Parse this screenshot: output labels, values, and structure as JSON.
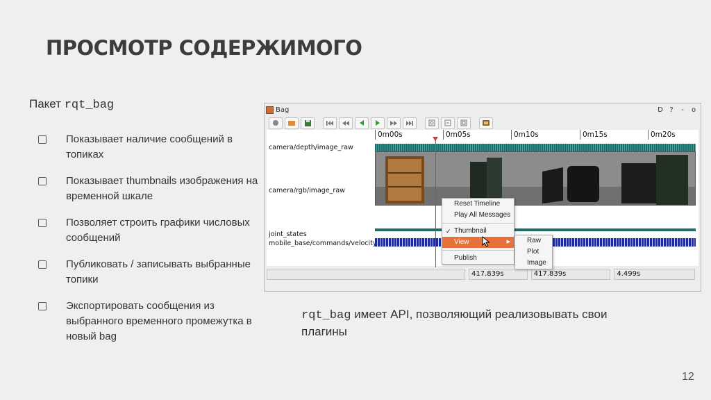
{
  "slide": {
    "title": "ПРОСМОТР СОДЕРЖИМОГО",
    "intro_prefix": "Пакет",
    "intro_code": "rqt_bag",
    "bullets": [
      "Показывает наличие сообщений в топиках",
      "Показывает thumbnails изображения на временной шкале",
      "Позволяет строить графики числовых сообщений",
      "Публиковать / записывать выбранные топики",
      "Экспортировать сообщения из выбранного временного промежутка в новый bag"
    ],
    "caption_code": "rqt_bag",
    "caption_text": " имеет API, позволяющий реализовывать свои плагины",
    "page_number": "12"
  },
  "window": {
    "title": "Bag",
    "title_controls": [
      "D",
      "?",
      "-",
      "o"
    ],
    "toolbar_icons": [
      "record-icon",
      "open-icon",
      "save-icon",
      "skip-start-icon",
      "rewind-icon",
      "play-backward-icon",
      "play-icon",
      "fast-forward-icon",
      "skip-end-icon",
      "zoom-in-icon",
      "zoom-out-icon",
      "zoom-reset-icon",
      "thumbnail-icon"
    ],
    "timeline": {
      "ticks": [
        "0m00s",
        "0m05s",
        "0m10s",
        "0m15s",
        "0m20s"
      ],
      "topics": [
        "camera/depth/image_raw",
        "camera/rgb/image_raw",
        "joint_states",
        "mobile_base/commands/velocity"
      ]
    },
    "status": {
      "start": "417.839s",
      "current": "417.839s",
      "duration": "4.499s"
    },
    "context_menu": {
      "items": [
        "Reset Timeline",
        "Play All Messages",
        "Thumbnail",
        "View",
        "Publish"
      ],
      "checked": "Thumbnail",
      "active": "View"
    },
    "submenu": {
      "items": [
        "Raw",
        "Plot",
        "Image"
      ]
    }
  }
}
